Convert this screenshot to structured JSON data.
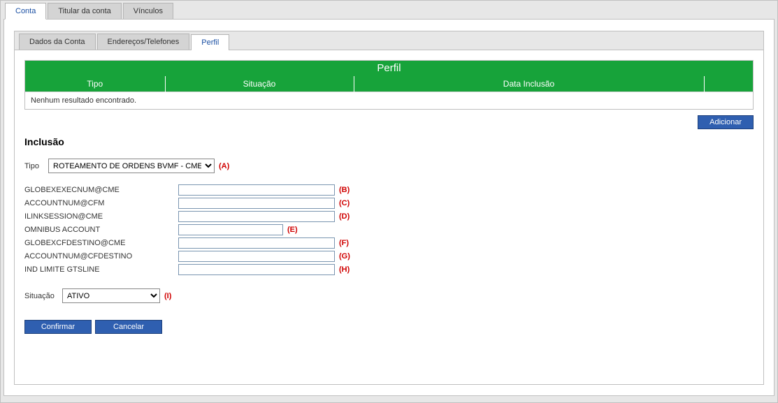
{
  "topTabs": {
    "t0": "Conta",
    "t1": "Titular da conta",
    "t2": "Vínculos"
  },
  "subTabs": {
    "s0": "Dados da Conta",
    "s1": "Endereços/Telefones",
    "s2": "Perfil"
  },
  "panel": {
    "title": "Perfil"
  },
  "table": {
    "col0": "Tipo",
    "col1": "Situação",
    "col2": "Data Inclusão",
    "empty": "Nenhum resultado encontrado."
  },
  "buttons": {
    "add": "Adicionar",
    "confirm": "Confirmar",
    "cancel": "Cancelar"
  },
  "section": {
    "heading": "Inclusão",
    "tipoLabel": "Tipo",
    "tipoValue": "ROTEAMENTO DE ORDENS BVMF - CME",
    "situacaoLabel": "Situação",
    "situacaoValue": "ATIVO"
  },
  "fields": {
    "f0": "GLOBEXEXECNUM@CME",
    "f1": "ACCOUNTNUM@CFM",
    "f2": "ILINKSESSION@CME",
    "f3": "OMNIBUS ACCOUNT",
    "f4": "GLOBEXCFDESTINO@CME",
    "f5": "ACCOUNTNUM@CFDESTINO",
    "f6": "IND LIMITE GTSLINE"
  },
  "markers": {
    "mA": "(A)",
    "mB": "(B)",
    "mC": "(C)",
    "mD": "(D)",
    "mE": "(E)",
    "mF": "(F)",
    "mG": "(G)",
    "mH": "(H)",
    "mI": "(I)"
  }
}
